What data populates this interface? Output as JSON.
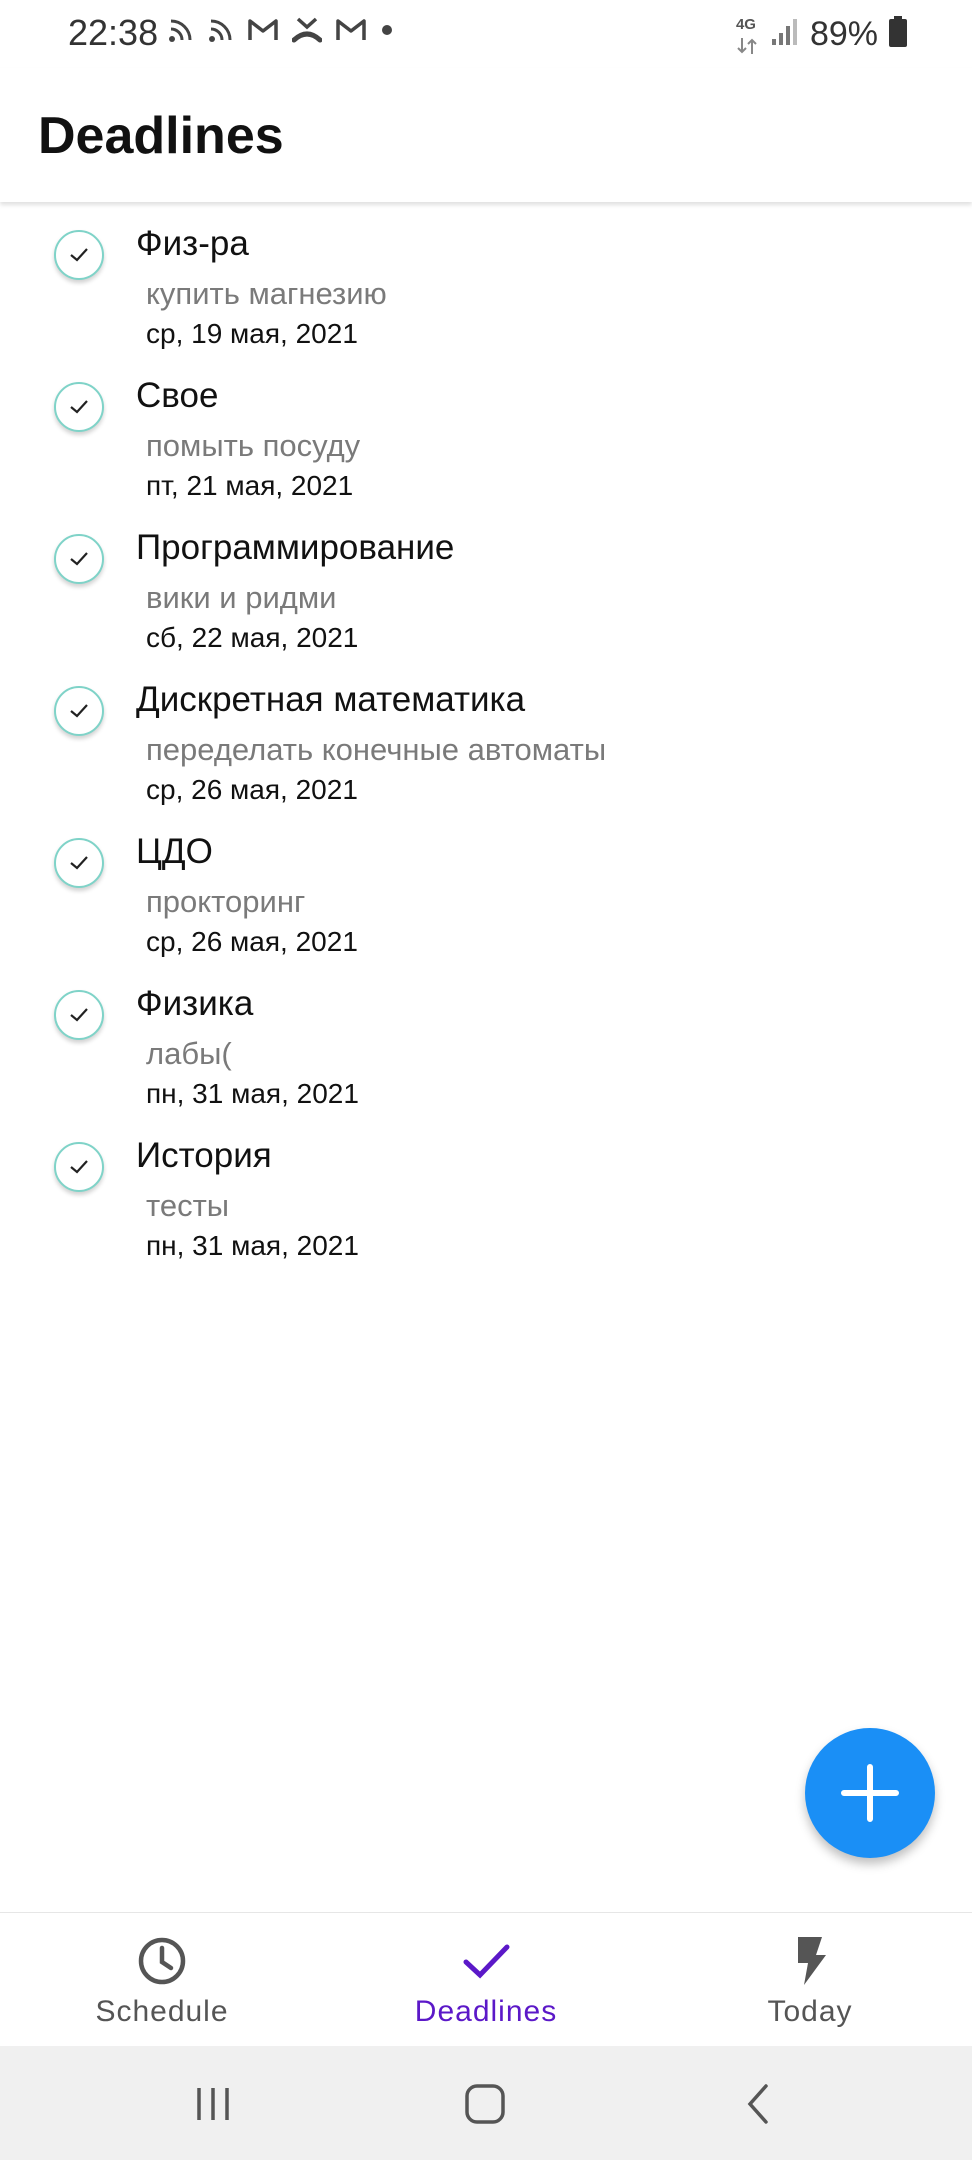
{
  "status_bar": {
    "time": "22:38",
    "network": "4G",
    "battery": "89%",
    "icons": [
      "rss-icon",
      "rss-icon",
      "gmail-icon",
      "missed-call-icon",
      "gmail-icon",
      "dot-icon"
    ]
  },
  "app_bar": {
    "title": "Deadlines"
  },
  "deadlines": [
    {
      "subject": "Физ-ра",
      "task": "купить магнезию",
      "date": "ср, 19 мая, 2021"
    },
    {
      "subject": "Свое",
      "task": "помыть посуду",
      "date": "пт, 21 мая, 2021"
    },
    {
      "subject": "Программирование",
      "task": "вики и ридми",
      "date": "сб, 22 мая, 2021"
    },
    {
      "subject": "Дискретная математика",
      "task": "переделать конечные автоматы",
      "date": "ср, 26 мая, 2021"
    },
    {
      "subject": "ЦДО",
      "task": "прокторинг",
      "date": "ср, 26 мая, 2021"
    },
    {
      "subject": "Физика",
      "task": "лабы(",
      "date": "пн, 31 мая, 2021"
    },
    {
      "subject": "История",
      "task": "тесты",
      "date": "пн, 31 мая, 2021"
    }
  ],
  "bottom_nav": {
    "items": [
      {
        "label": "Schedule",
        "icon": "clock-icon",
        "active": false
      },
      {
        "label": "Deadlines",
        "icon": "check-icon",
        "active": true
      },
      {
        "label": "Today",
        "icon": "lightning-icon",
        "active": false
      }
    ]
  },
  "colors": {
    "accent": "#5b18c8",
    "fab": "#1a8ff6",
    "check_border": "#7fd3c8",
    "task_text": "#7a7a7a"
  }
}
